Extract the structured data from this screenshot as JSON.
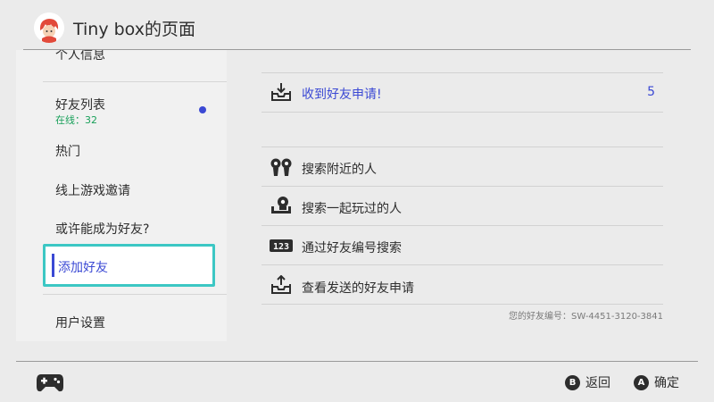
{
  "header": {
    "title": "Tiny box的页面"
  },
  "sidebar": {
    "items": [
      {
        "label": "个人信息"
      },
      {
        "label": "好友列表",
        "sub": "在线：32"
      },
      {
        "label": "热门"
      },
      {
        "label": "线上游戏邀请"
      },
      {
        "label": "或许能成为好友?"
      },
      {
        "label": "添加好友"
      },
      {
        "label": "用户设置"
      }
    ]
  },
  "main": {
    "requests": {
      "label": "收到好友申请!",
      "count": "5"
    },
    "options": [
      {
        "label": "搜索附近的人",
        "icon": "nearby-people-icon"
      },
      {
        "label": "搜索一起玩过的人",
        "icon": "played-with-icon"
      },
      {
        "label": "通过好友编号搜索",
        "icon": "friend-code-icon"
      },
      {
        "label": "查看发送的好友申请",
        "icon": "sent-requests-icon"
      }
    ],
    "friend_code": "您的好友编号：SW-4451-3120-3841"
  },
  "footer": {
    "back": {
      "key": "B",
      "label": "返回"
    },
    "ok": {
      "key": "A",
      "label": "确定"
    }
  },
  "colors": {
    "accent": "#3b49d4",
    "focus": "#3cc7c4",
    "online": "#19a05a",
    "background": "#ebebeb"
  }
}
